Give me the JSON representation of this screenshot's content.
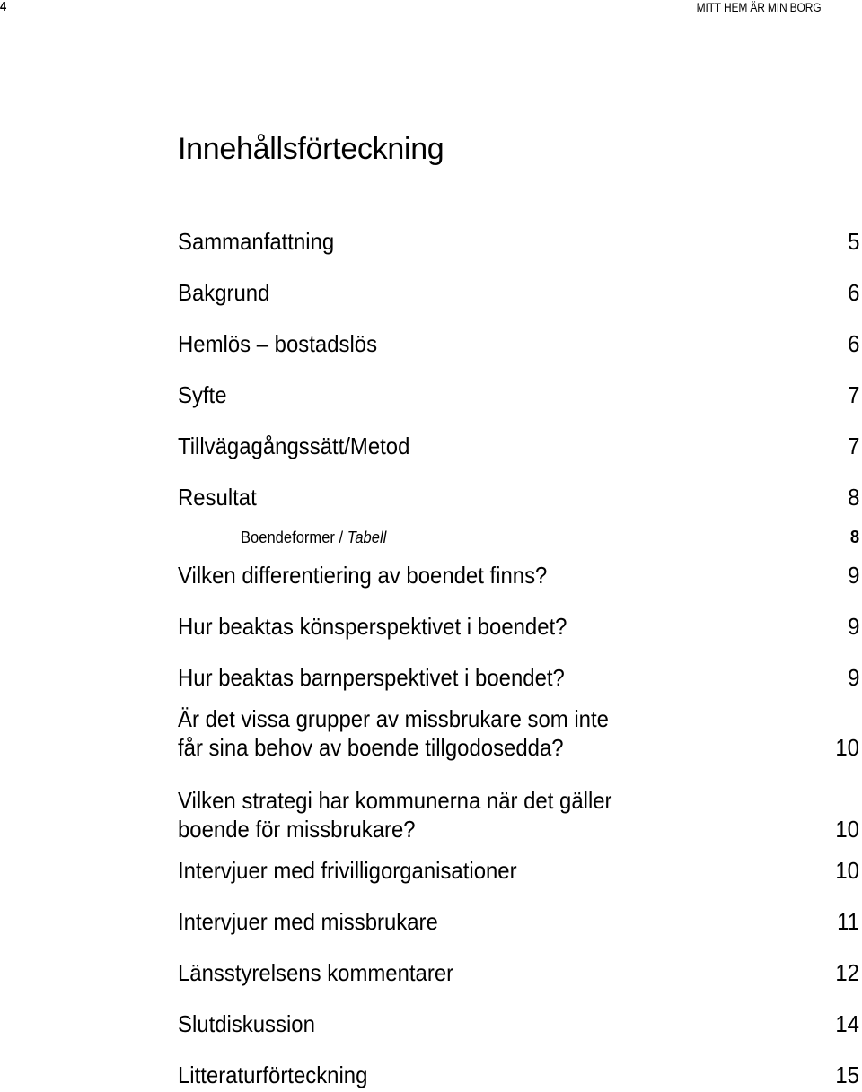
{
  "header": {
    "page_number": "4",
    "running_title": "MITT HEM ÄR MIN BORG"
  },
  "toc": {
    "title": "Innehållsförteckning",
    "entries": [
      {
        "label": "Sammanfattning",
        "page": "5"
      },
      {
        "label": "Bakgrund",
        "page": "6"
      },
      {
        "label": "Hemlös – bostadslös",
        "page": "6"
      },
      {
        "label": "Syfte",
        "page": "7"
      },
      {
        "label": "Tillvägagångssätt/Metod",
        "page": "7"
      },
      {
        "label": "Resultat",
        "page": "8"
      },
      {
        "label": "Boendeformer / ",
        "label_italic": "Tabell",
        "page": "8",
        "level": 2
      },
      {
        "label": "Vilken differentiering av boendet finns?",
        "page": "9"
      },
      {
        "label": "Hur beaktas könsperspektivet i boendet?",
        "page": "9"
      },
      {
        "label": "Hur beaktas barnperspektivet i boendet?",
        "page": "9"
      },
      {
        "label": "Är det vissa grupper av missbrukare som inte",
        "label_line2": "får sina behov av boende tillgodosedda?",
        "page": "10"
      },
      {
        "label": "Vilken strategi har kommunerna när det gäller",
        "label_line2": "boende för missbrukare?",
        "page": "10"
      },
      {
        "label": "Intervjuer med frivilligorganisationer",
        "page": "10"
      },
      {
        "label": "Intervjuer med missbrukare",
        "page": "11"
      },
      {
        "label": "Länsstyrelsens kommentarer",
        "page": "12"
      },
      {
        "label": "Slutdiskussion",
        "page": "14"
      },
      {
        "label": "Litteraturförteckning",
        "page": "15"
      }
    ]
  }
}
